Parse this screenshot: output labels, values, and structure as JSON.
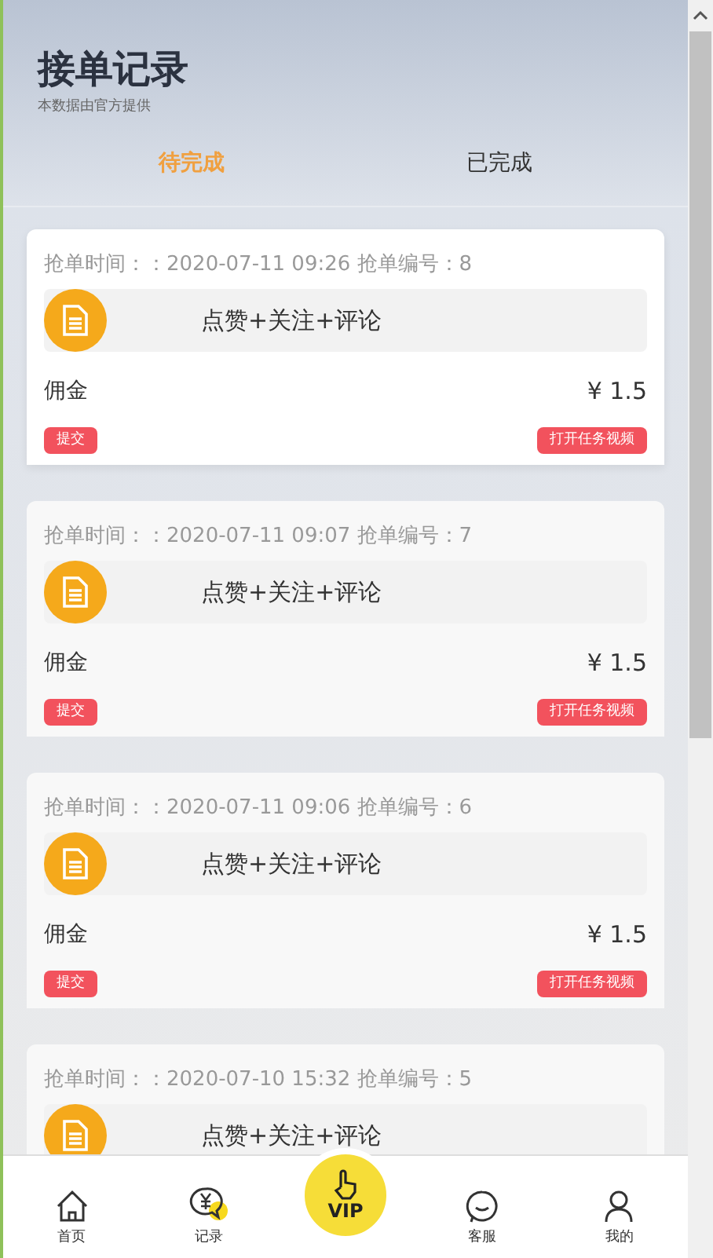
{
  "header": {
    "title": "接单记录",
    "subtitle": "本数据由官方提供"
  },
  "tabs": [
    {
      "label": "待完成",
      "selected": true
    },
    {
      "label": "已完成",
      "selected": false
    }
  ],
  "orders": [
    {
      "time_line": "抢单时间：：2020-07-11 09:26 抢单编号：8",
      "task": "点赞+关注+评论",
      "commission_label": "佣金",
      "amount": "¥ 1.5",
      "submit": "提交",
      "open_video": "打开任务视频"
    },
    {
      "time_line": "抢单时间：：2020-07-11 09:07 抢单编号：7",
      "task": "点赞+关注+评论",
      "commission_label": "佣金",
      "amount": "¥ 1.5",
      "submit": "提交",
      "open_video": "打开任务视频"
    },
    {
      "time_line": "抢单时间：：2020-07-11 09:06 抢单编号：6",
      "task": "点赞+关注+评论",
      "commission_label": "佣金",
      "amount": "¥ 1.5",
      "submit": "提交",
      "open_video": "打开任务视频"
    },
    {
      "time_line": "抢单时间：：2020-07-10 15:32 抢单编号：5",
      "task": "点赞+关注+评论"
    }
  ],
  "bottom_nav": [
    {
      "kind": "home",
      "label": "首页"
    },
    {
      "kind": "records",
      "label": "记录"
    },
    {
      "kind": "vip",
      "label": "VIP"
    },
    {
      "kind": "service",
      "label": "客服"
    },
    {
      "kind": "profile",
      "label": "我的"
    }
  ]
}
